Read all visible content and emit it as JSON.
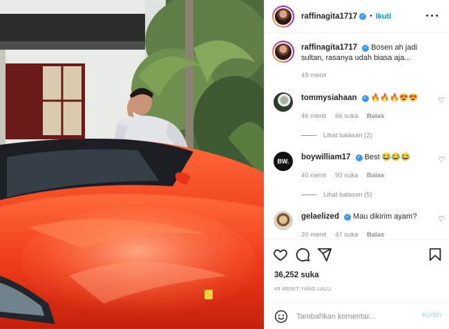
{
  "post_image": {
    "description_icon": "photo-image"
  },
  "header": {
    "username": "raffinagita1717",
    "verified_icon": "verified-badge-icon",
    "separator": "•",
    "follow_label": "Ikuti",
    "more_icon": "more-options-icon"
  },
  "caption": {
    "username": "raffinagita1717",
    "text": "Bosen ah jadi sultan, rasanya udah biasa aja...",
    "time": "49 menit"
  },
  "comments": [
    {
      "username": "tommysiahaan",
      "verified": true,
      "text": "🔥🔥🔥😍😍",
      "time": "46 menit",
      "likes": "66 suka",
      "reply": "Balas",
      "view_replies": "Lihat balasan (2)"
    },
    {
      "username": "boywilliam17",
      "verified": true,
      "text": "Best 😂😂😂",
      "time": "40 menit",
      "likes": "93 suka",
      "reply": "Balas",
      "view_replies": "Lihat balasan (5)",
      "avatar_text": "BW."
    },
    {
      "username": "gelaelized",
      "verified": true,
      "text": "Mau dikirim ayam?",
      "time": "20 menit",
      "likes": "47 suka",
      "reply": "Balas"
    }
  ],
  "actions": {
    "like_icon": "heart-icon",
    "comment_icon": "comment-icon",
    "share_icon": "share-icon",
    "save_icon": "bookmark-icon",
    "likes_count": "36,252 suka",
    "time_ago": "49 MENIT YANG LALU"
  },
  "add_comment": {
    "emoji_icon": "smiley-icon",
    "placeholder": "Tambahkan komentar...",
    "post_label": "Kirim"
  },
  "colors": {
    "accent": "#0095f6",
    "verified": "#3897f0",
    "muted": "#8e8e8e",
    "post_disabled": "#b2dffc"
  }
}
